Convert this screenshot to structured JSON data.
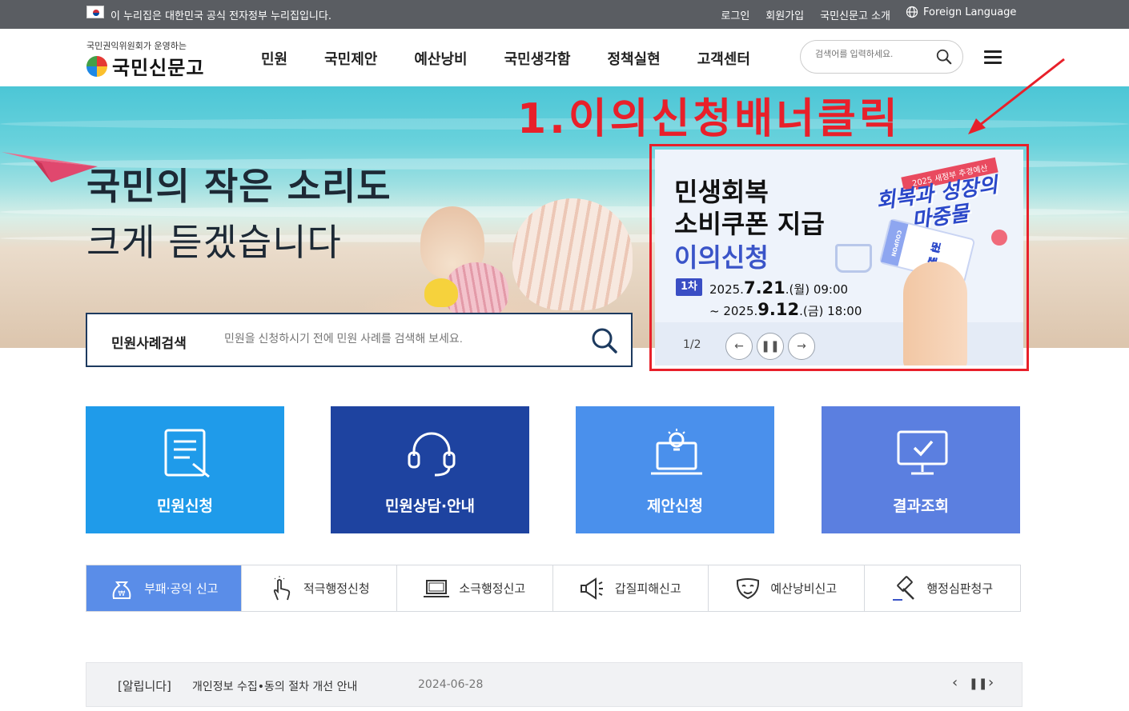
{
  "gov_bar": {
    "notice": "이 누리집은 대한민국 공식 전자정부 누리집입니다.",
    "links": [
      "로그인",
      "회원가입",
      "국민신문고 소개"
    ],
    "language": "Foreign Language"
  },
  "header": {
    "logo_sub": "국민권익위원회가 운영하는",
    "logo_main": "국민신문고",
    "nav": [
      "민원",
      "국민제안",
      "예산낭비",
      "국민생각함",
      "정책실현",
      "고객센터"
    ],
    "search_placeholder": "검색어를 입력하세요."
  },
  "hero": {
    "title_line1": "국민의 작은 소리도",
    "title_line2": "크게 듣겠습니다",
    "case_search_label": "민원사례검색",
    "case_search_placeholder": "민원을 신청하시기 전에 민원 사례를 검색해 보세요."
  },
  "annotation": {
    "text": "1.이의신청배너클릭",
    "color": "#e8202a"
  },
  "banner": {
    "line1": "민생회복",
    "line2": "소비쿠폰 지급",
    "line3": "이의신청",
    "badge": "1차",
    "date1_prefix": "2025.",
    "date1_main": "7.21",
    "date1_suffix": ".(월) 09:00",
    "date2_prefix": "~ 2025.",
    "date2_main": "9.12",
    "date2_suffix": ".(금) 18:00",
    "pager": "1/2",
    "tag": "2025 새정부 추경예산",
    "headline1": "회복과 성장의",
    "headline2": "마중물",
    "coupon_line1": "민생회복",
    "coupon_line2": "소비쿠폰",
    "coupon_side": "COUPON"
  },
  "quick_menu": [
    {
      "label": "민원신청",
      "color": "#1f9bea",
      "icon": "document-icon"
    },
    {
      "label": "민원상담·안내",
      "color": "#1e43a0",
      "icon": "headset-icon"
    },
    {
      "label": "제안신청",
      "color": "#4a90ec",
      "icon": "lightbulb-laptop-icon"
    },
    {
      "label": "결과조회",
      "color": "#5b7fe0",
      "icon": "monitor-check-icon"
    }
  ],
  "report_tabs": [
    {
      "label": "부패·공익 신고",
      "icon": "money-bag-icon"
    },
    {
      "label": "적극행정신청",
      "icon": "hand-pointer-icon"
    },
    {
      "label": "소극행정신고",
      "icon": "laptop-icon"
    },
    {
      "label": "갑질피해신고",
      "icon": "megaphone-icon"
    },
    {
      "label": "예산낭비신고",
      "icon": "mask-icon"
    },
    {
      "label": "행정심판청구",
      "icon": "gavel-icon"
    }
  ],
  "notice": {
    "tag": "[알립니다]",
    "title": "개인정보 수집•동의 절차 개선 안내",
    "date": "2024-06-28"
  }
}
